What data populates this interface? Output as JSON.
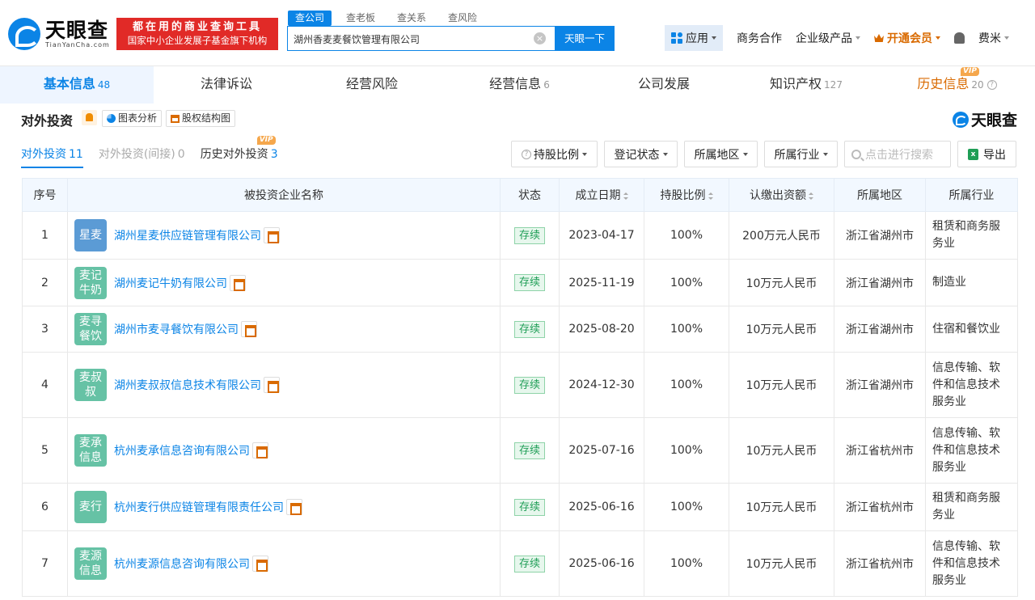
{
  "brand": {
    "name": "天眼查",
    "domain": "TianYanCha.com",
    "slogan_line1": "都在用的商业查询工具",
    "slogan_line2": "国家中小企业发展子基金旗下机构",
    "accent": "#0b84e6"
  },
  "search": {
    "tabs": [
      "查公司",
      "查老板",
      "查关系",
      "查风险"
    ],
    "value": "湖州香麦麦餐饮管理有限公司",
    "button": "天眼一下"
  },
  "nav": {
    "apps": "应用",
    "business": "商务合作",
    "enterprise": "企业级产品",
    "vip": "开通会员",
    "user": "费米"
  },
  "main_tabs": [
    {
      "label": "基本信息",
      "count": "48"
    },
    {
      "label": "法律诉讼",
      "count": ""
    },
    {
      "label": "经营风险",
      "count": ""
    },
    {
      "label": "经营信息",
      "count": "6"
    },
    {
      "label": "公司发展",
      "count": ""
    },
    {
      "label": "知识产权",
      "count": "127"
    },
    {
      "label": "历史信息",
      "count": "20",
      "badge": "VIP"
    }
  ],
  "section": {
    "title": "对外投资",
    "chart_btn": "图表分析",
    "equity_btn": "股权结构图",
    "brand": "天眼查",
    "subtabs": [
      {
        "label": "对外投资",
        "count": "11"
      },
      {
        "label": "对外投资(间接)",
        "count": "0"
      },
      {
        "label": "历史对外投资",
        "count": "3",
        "badge": "VIP"
      }
    ],
    "filters": {
      "ratio": "持股比例",
      "status": "登记状态",
      "region": "所属地区",
      "industry": "所属行业",
      "search_placeholder": "点击进行搜索",
      "export": "导出"
    }
  },
  "table": {
    "headers": [
      "序号",
      "被投资企业名称",
      "状态",
      "成立日期",
      "持股比例",
      "认缴出资额",
      "所属地区",
      "所属行业"
    ],
    "rows": [
      {
        "no": "1",
        "logo": "星麦",
        "logo_color": "#5b9bd5",
        "name": "湖州星麦供应链管理有限公司",
        "status": "存续",
        "date": "2023-04-17",
        "ratio": "100%",
        "capital": "200万元人民币",
        "region": "浙江省湖州市",
        "industry": "租赁和商务服务业"
      },
      {
        "no": "2",
        "logo": "麦记牛奶",
        "logo_color": "#66c2a5",
        "name": "湖州麦记牛奶有限公司",
        "status": "存续",
        "date": "2025-11-19",
        "ratio": "100%",
        "capital": "10万元人民币",
        "region": "浙江省湖州市",
        "industry": "制造业"
      },
      {
        "no": "3",
        "logo": "麦寻餐饮",
        "logo_color": "#66c2a5",
        "name": "湖州市麦寻餐饮有限公司",
        "status": "存续",
        "date": "2025-08-20",
        "ratio": "100%",
        "capital": "10万元人民币",
        "region": "浙江省湖州市",
        "industry": "住宿和餐饮业"
      },
      {
        "no": "4",
        "logo": "麦叔叔",
        "logo_color": "#66c2a5",
        "name": "湖州麦叔叔信息技术有限公司",
        "status": "存续",
        "date": "2024-12-30",
        "ratio": "100%",
        "capital": "10万元人民币",
        "region": "浙江省湖州市",
        "industry": "信息传输、软件和信息技术服务业"
      },
      {
        "no": "5",
        "logo": "麦承信息",
        "logo_color": "#66c2a5",
        "name": "杭州麦承信息咨询有限公司",
        "status": "存续",
        "date": "2025-07-16",
        "ratio": "100%",
        "capital": "10万元人民币",
        "region": "浙江省杭州市",
        "industry": "信息传输、软件和信息技术服务业"
      },
      {
        "no": "6",
        "logo": "麦行",
        "logo_color": "#66c2a5",
        "name": "杭州麦行供应链管理有限责任公司",
        "status": "存续",
        "date": "2025-06-16",
        "ratio": "100%",
        "capital": "10万元人民币",
        "region": "浙江省杭州市",
        "industry": "租赁和商务服务业"
      },
      {
        "no": "7",
        "logo": "麦源信息",
        "logo_color": "#66c2a5",
        "name": "杭州麦源信息咨询有限公司",
        "status": "存续",
        "date": "2025-06-16",
        "ratio": "100%",
        "capital": "10万元人民币",
        "region": "浙江省杭州市",
        "industry": "信息传输、软件和信息技术服务业"
      }
    ]
  }
}
